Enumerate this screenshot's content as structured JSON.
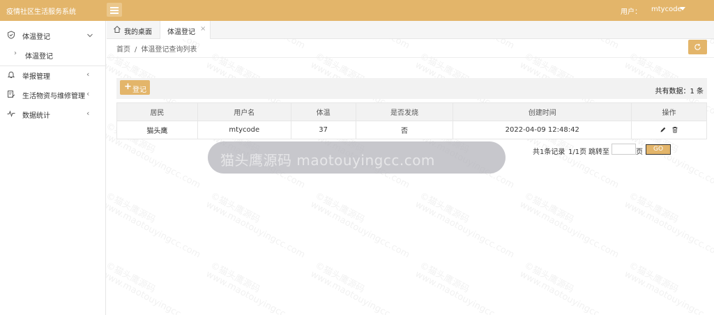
{
  "header": {
    "app_title": "疫情社区生活服务系统",
    "user_label": "用户：",
    "user_name": "mtycode"
  },
  "sidebar": {
    "items": [
      {
        "label": "体温登记",
        "icon": "shield-check-icon",
        "expanded": true
      },
      {
        "label": "体温登记",
        "sub": true
      },
      {
        "label": "举报管理",
        "icon": "bell-icon"
      },
      {
        "label": "生活物资与维修管理",
        "icon": "edit-document-icon"
      },
      {
        "label": "数据统计",
        "icon": "pulse-icon"
      }
    ]
  },
  "tabs": [
    {
      "label": "我的桌面",
      "icon": "home-icon"
    },
    {
      "label": "体温登记",
      "close": "×",
      "active": true
    }
  ],
  "breadcrumb": {
    "home": "首页",
    "separator": "/",
    "current": "体温登记查询列表"
  },
  "toolbar": {
    "add_label": "登记",
    "total_text": "共有数据：1 条"
  },
  "table": {
    "columns": [
      "居民",
      "用户名",
      "体温",
      "是否发烧",
      "创建时间",
      "操作"
    ],
    "rows": [
      {
        "resident": "猫头鹰",
        "username": "mtycode",
        "temperature": "37",
        "fever": "否",
        "created": "2022-04-09 12:48:42"
      }
    ]
  },
  "pagination": {
    "summary": "共1条记录",
    "pages": "1/1页",
    "jump_label": "跳转至",
    "page_suffix": "页",
    "go_label": "GO",
    "jump_value": ""
  },
  "watermark": {
    "banner": "猫头鹰源码 maotouyingcc.com",
    "tile_line1": "©猫头鹰源码",
    "tile_line2": "www.maotouyingcc.com"
  },
  "colors": {
    "accent": "#e3b56a",
    "header_bg": "#e3b56a",
    "table_header_bg": "#f2f2f2"
  }
}
